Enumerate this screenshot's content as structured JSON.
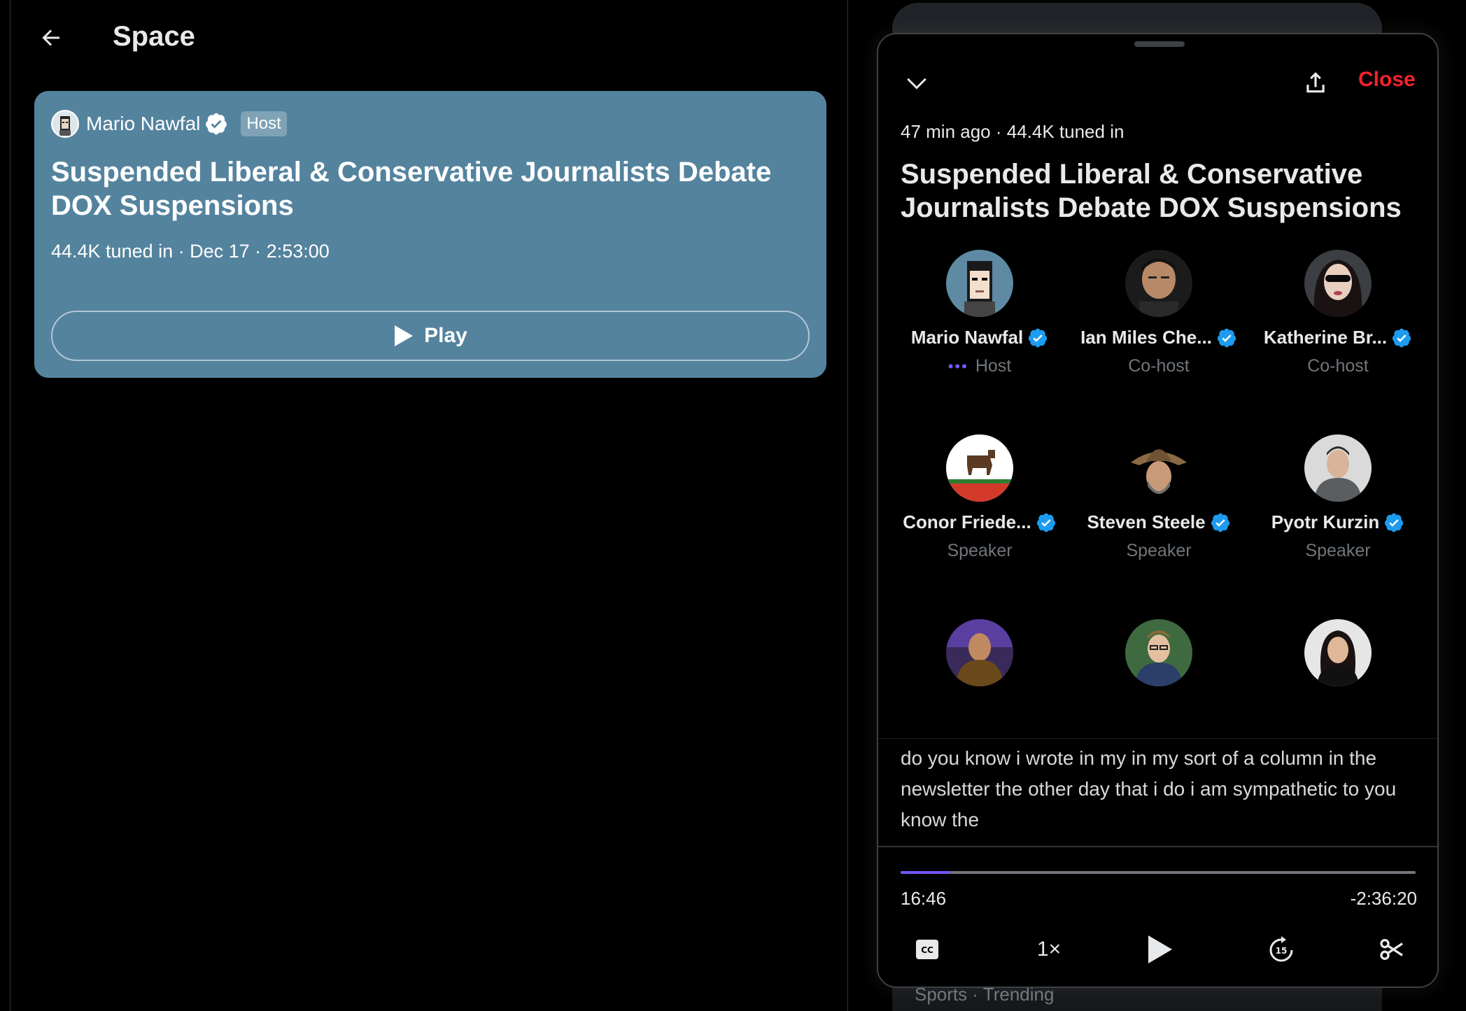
{
  "header": {
    "title": "Space"
  },
  "card": {
    "host_name": "Mario Nawfal",
    "host_badge": "Host",
    "title": "Suspended Liberal & Conservative Journalists Debate DOX Suspensions",
    "meta": "44.4K tuned in · Dec 17 · 2:53:00",
    "play_label": "Play",
    "background_color": "#54839e"
  },
  "sidebar": {
    "trending_label": "Sports · Trending"
  },
  "dock": {
    "close_label": "Close",
    "meta": "47 min ago · 44.4K tuned in",
    "title": "Suspended Liberal & Conservative Journalists Debate DOX Suspensions",
    "participants": [
      {
        "name": "Mario Nawfal",
        "role": "Host",
        "speaking": true
      },
      {
        "name": "Ian Miles Che...",
        "role": "Co-host"
      },
      {
        "name": "Katherine Br...",
        "role": "Co-host"
      },
      {
        "name": "Conor Friede...",
        "role": "Speaker"
      },
      {
        "name": "Steven Steele",
        "role": "Speaker"
      },
      {
        "name": "Pyotr Kurzin",
        "role": "Speaker"
      },
      {
        "name": "",
        "role": ""
      },
      {
        "name": "",
        "role": ""
      },
      {
        "name": "",
        "role": ""
      }
    ],
    "transcript": "do you know i wrote in my in my sort of a column in the newsletter the other day that i do i am sympathetic to you know the",
    "player": {
      "elapsed": "16:46",
      "remaining": "-2:36:20",
      "progress_fraction": 0.097,
      "speed_label": "1×",
      "accent_color": "#7856ff"
    },
    "close_color": "#f4212e",
    "verified_color": "#1d9bf0"
  }
}
